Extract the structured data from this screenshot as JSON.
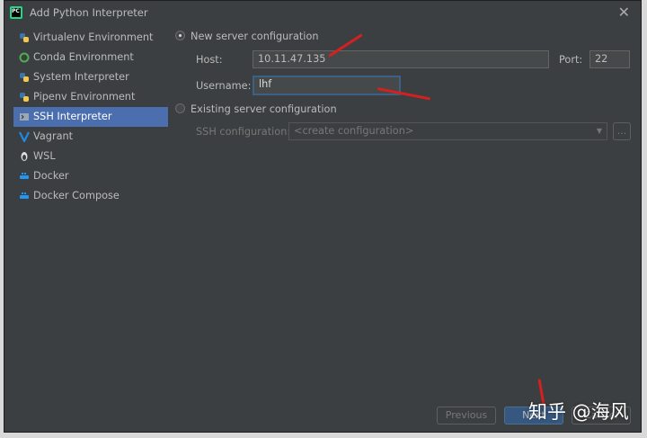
{
  "window": {
    "title": "Add Python Interpreter"
  },
  "sidebar": {
    "items": [
      {
        "label": "Virtualenv Environment",
        "icon": "python-icon"
      },
      {
        "label": "Conda Environment",
        "icon": "conda-icon"
      },
      {
        "label": "System Interpreter",
        "icon": "python-icon"
      },
      {
        "label": "Pipenv Environment",
        "icon": "python-icon"
      },
      {
        "label": "SSH Interpreter",
        "icon": "terminal-icon"
      },
      {
        "label": "Vagrant",
        "icon": "vagrant-icon"
      },
      {
        "label": "WSL",
        "icon": "linux-icon"
      },
      {
        "label": "Docker",
        "icon": "docker-icon"
      },
      {
        "label": "Docker Compose",
        "icon": "docker-icon"
      }
    ],
    "selected": "SSH Interpreter"
  },
  "config": {
    "new_server_label": "New server configuration",
    "host_label": "Host:",
    "host_value": "10.11.47.135",
    "port_label": "Port:",
    "port_value": "22",
    "username_label": "Username:",
    "username_value": "lhf",
    "existing_label": "Existing server configuration",
    "ssh_config_label": "SSH configuration:",
    "ssh_config_placeholder": "<create configuration>",
    "browse_label": "..."
  },
  "footer": {
    "previous_label": "Previous",
    "next_label": "Next",
    "cancel_label": "Cancel"
  },
  "watermark": "知乎 @海风",
  "colors": {
    "selection": "#4b6eaf",
    "annotation": "#d62020",
    "background": "#3c3f41"
  }
}
